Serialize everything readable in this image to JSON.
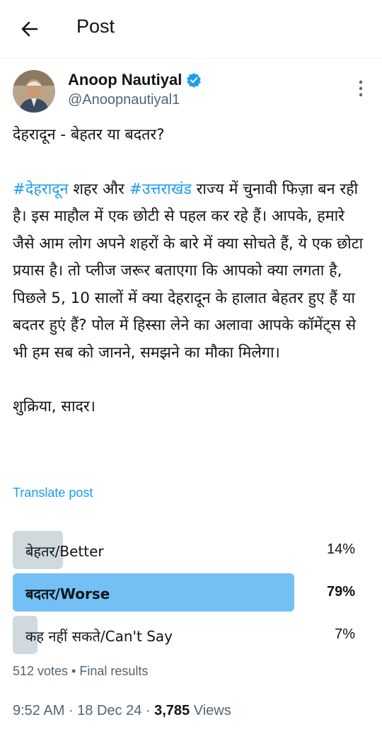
{
  "header": {
    "title": "Post"
  },
  "author": {
    "name": "Anoop Nautiyal",
    "handle": "@Anoopnautiyal1",
    "verified_color": "#1d9bf0"
  },
  "post": {
    "headline": "देहरादून - बेहतर या बदतर?",
    "hashtag1": "#देहरादून",
    "text1": " शहर और ",
    "hashtag2": "#उत्तराखंड",
    "text2": " राज्य में चुनावी फिज़ा बन रही है। इस माहौल में एक छोटी से पहल कर रहे हैं। आपके, हमारे जैसे आम लोग अपने शहरों के बारे में क्या सोचते हैं, ये एक छोटा प्रयास है। तो प्लीज जरूर बताएगा कि आपको क्या लगता है, पिछले 5, 10 सालों में क्या देहरादून के हालात बेहतर हुए हैं या बदतर हुएं हैं? पोल में हिस्सा लेने का अलावा आपके कॉमेंट्स से भी हम सब को जानने, समझने का मौका मिलेगा।",
    "closing": "शुक्रिया, सादर।",
    "translate": "Translate post"
  },
  "poll": {
    "options": [
      {
        "label": "बेहतर/Better",
        "percent_text": "14%",
        "fill": 0.14,
        "winner": false
      },
      {
        "label": "बदतर/Worse",
        "percent_text": "79%",
        "fill": 0.79,
        "winner": true
      },
      {
        "label": "कह नहीं सकते/Can't Say",
        "percent_text": "7%",
        "fill": 0.07,
        "winner": false
      }
    ],
    "results": "512 votes • Final results"
  },
  "meta": {
    "time": "9:52 AM · 18 Dec 24 · ",
    "views_count": "3,785",
    "views_label": " Views"
  },
  "colors": {
    "accent": "#1d9bf0",
    "winner_bar": "#74c0f4",
    "bar": "#cfd9de"
  },
  "icons": {
    "back": "arrow-left-icon",
    "verified": "verified-badge-icon",
    "more": "more-vertical-icon"
  }
}
